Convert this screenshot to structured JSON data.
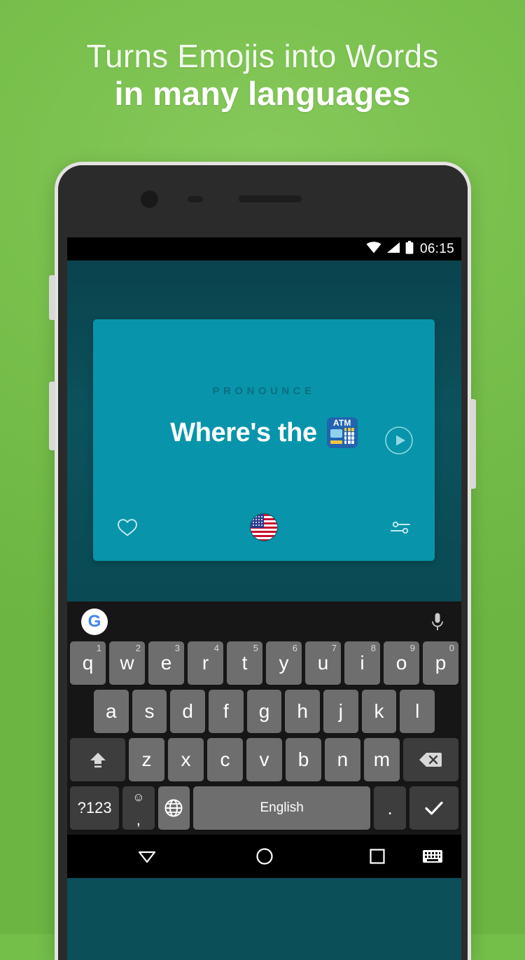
{
  "promo": {
    "headline_line1": "Turns Emojis into Words",
    "headline_line2": "in many languages",
    "background_color": "#74be4a",
    "headline_color": "#ffffff"
  },
  "phone": {
    "camera_icon": "camera-icon",
    "sensor_icon": "sensor-icon",
    "speaker_icon": "speaker-grille-icon"
  },
  "status_bar": {
    "time": "06:15",
    "wifi_icon": "wifi-icon",
    "signal_icon": "signal-icon",
    "battery_icon": "battery-icon",
    "background_color": "#000000"
  },
  "app": {
    "background_color": "#0b4f59",
    "card": {
      "background_color": "#0895ab",
      "section_label": "PRONOUNCE",
      "phrase_text": "Where's the",
      "phrase_emoji": "ATM",
      "emoji_name": "atm-emoji",
      "play_button_label": "play-icon",
      "favorite_icon": "heart-icon",
      "language_flag": "us-flag",
      "settings_icon": "sliders-icon"
    }
  },
  "keyboard": {
    "background_color": "#161616",
    "key_color": "#6e6e6e",
    "suggestion_bar": {
      "google_logo": "G",
      "mic_icon": "microphone-icon"
    },
    "row1": [
      {
        "label": "q",
        "sup": "1"
      },
      {
        "label": "w",
        "sup": "2"
      },
      {
        "label": "e",
        "sup": "3"
      },
      {
        "label": "r",
        "sup": "4"
      },
      {
        "label": "t",
        "sup": "5"
      },
      {
        "label": "y",
        "sup": "6"
      },
      {
        "label": "u",
        "sup": "7"
      },
      {
        "label": "i",
        "sup": "8"
      },
      {
        "label": "o",
        "sup": "9"
      },
      {
        "label": "p",
        "sup": "0"
      }
    ],
    "row2": [
      {
        "label": "a"
      },
      {
        "label": "s"
      },
      {
        "label": "d"
      },
      {
        "label": "f"
      },
      {
        "label": "g"
      },
      {
        "label": "h"
      },
      {
        "label": "j"
      },
      {
        "label": "k"
      },
      {
        "label": "l"
      }
    ],
    "row3": [
      {
        "label": "z"
      },
      {
        "label": "x"
      },
      {
        "label": "c"
      },
      {
        "label": "v"
      },
      {
        "label": "b"
      },
      {
        "label": "n"
      },
      {
        "label": "m"
      }
    ],
    "shift_key": "shift-icon",
    "backspace_key": "backspace-icon",
    "row4": {
      "symbols_key": "?123",
      "emoji_key": "☺",
      "comma_key": ",",
      "globe_key": "globe-icon",
      "space_key": "English",
      "period_key": ".",
      "enter_key": "checkmark-icon"
    }
  },
  "nav_bar": {
    "back": "back-triangle-icon",
    "home": "home-circle-icon",
    "recents": "recents-square-icon",
    "keyboard": "keyboard-icon",
    "background_color": "#000000"
  }
}
